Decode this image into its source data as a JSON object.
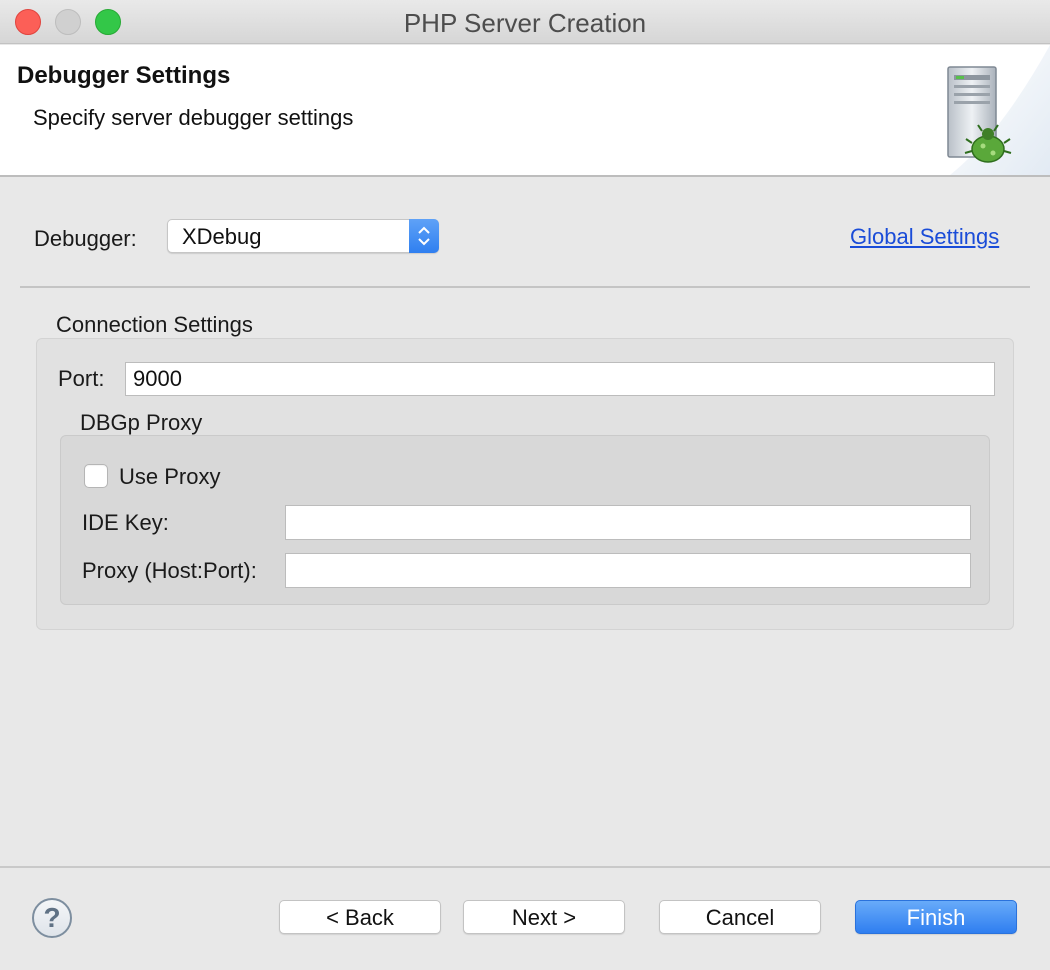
{
  "window": {
    "title": "PHP Server Creation"
  },
  "banner": {
    "title": "Debugger Settings",
    "description": "Specify server debugger settings",
    "image_icon": "server-bug-icon"
  },
  "debugger": {
    "label": "Debugger:",
    "selected": "XDebug",
    "global_settings_link": "Global Settings"
  },
  "connection": {
    "group_label": "Connection Settings",
    "port_label": "Port:",
    "port_value": "9000",
    "proxy": {
      "group_label": "DBGp Proxy",
      "use_proxy_label": "Use Proxy",
      "use_proxy_checked": false,
      "ide_key_label": "IDE Key:",
      "ide_key_value": "",
      "proxy_label": "Proxy (Host:Port):",
      "proxy_value": ""
    }
  },
  "footer": {
    "help_icon": "question-icon",
    "back": "< Back",
    "next": "Next >",
    "cancel": "Cancel",
    "finish": "Finish"
  },
  "colors": {
    "accent": "#2f7ff0",
    "link": "#1a4cd8",
    "close": "#fc5f57",
    "maximize": "#33c748"
  }
}
